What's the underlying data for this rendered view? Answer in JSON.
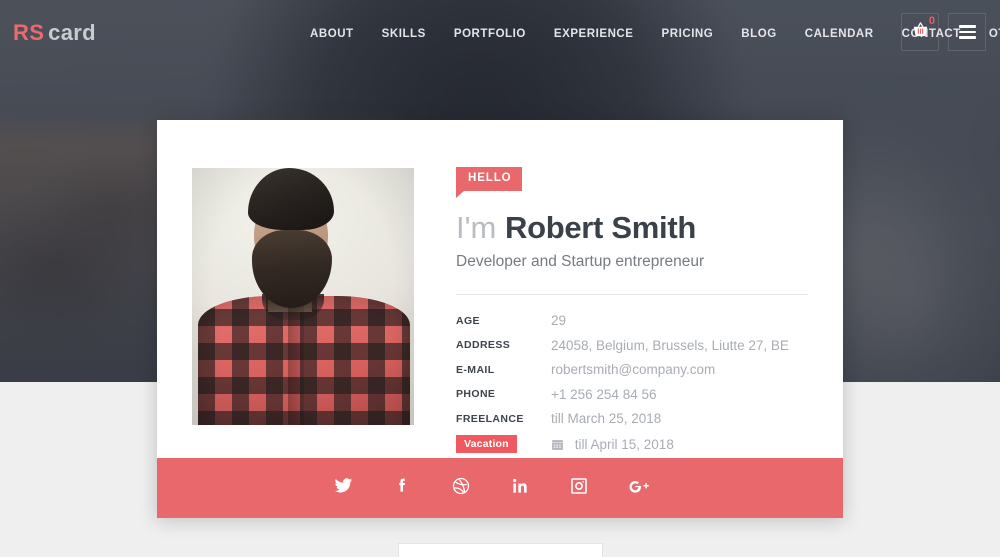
{
  "brand": {
    "part1": "RS",
    "part2": "card"
  },
  "nav": {
    "items": [
      {
        "label": "ABOUT"
      },
      {
        "label": "SKILLS"
      },
      {
        "label": "PORTFOLIO"
      },
      {
        "label": "EXPERIENCE"
      },
      {
        "label": "PRICING"
      },
      {
        "label": "BLOG"
      },
      {
        "label": "CALENDAR"
      },
      {
        "label": "CONTACT"
      },
      {
        "label": "OTHER"
      }
    ]
  },
  "header": {
    "cart_icon": "basket-icon",
    "cart_count": "0",
    "menu_icon": "hamburger-menu-icon"
  },
  "card": {
    "badge": "HELLO",
    "greeting": "I'm",
    "name": "Robert Smith",
    "subtitle": "Developer and Startup entrepreneur",
    "portrait_alt": "bearded-man-plaid-shirt",
    "details": [
      {
        "label": "AGE",
        "value": "29"
      },
      {
        "label": "ADDRESS",
        "value": "24058, Belgium, Brussels, Liutte 27, BE"
      },
      {
        "label": "E-MAIL",
        "value": "robertsmith@company.com"
      },
      {
        "label": "PHONE",
        "value": "+1 256 254 84 56"
      },
      {
        "label": "FREELANCE",
        "value": "till March 25, 2018"
      }
    ],
    "vacation": {
      "badge": "Vacation",
      "value": "till April 15, 2018",
      "icon": "calendar-icon"
    }
  },
  "social": [
    {
      "name": "twitter",
      "label": "Twitter"
    },
    {
      "name": "facebook",
      "label": "Facebook"
    },
    {
      "name": "dribbble",
      "label": "Dribbble"
    },
    {
      "name": "linkedin",
      "label": "LinkedIn"
    },
    {
      "name": "instagram",
      "label": "Instagram"
    },
    {
      "name": "googleplus",
      "label": "Google Plus"
    }
  ],
  "colors": {
    "accent": "#e9686b",
    "accent_strong": "#ee5a5f",
    "hero_overlay": "#4a4f58",
    "page_bg": "#efefef",
    "heading": "#3b4149",
    "muted": "#a8adb4"
  }
}
